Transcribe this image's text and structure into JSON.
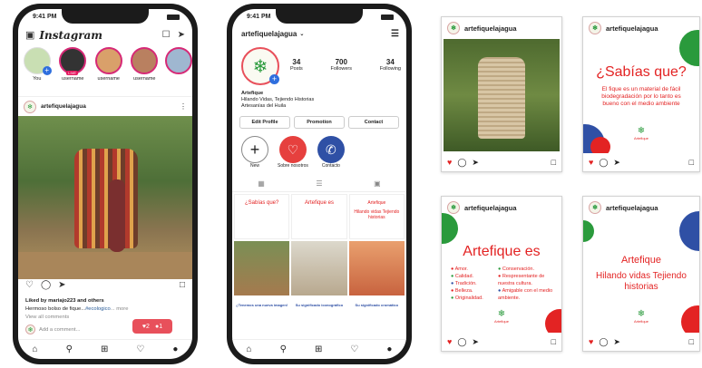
{
  "phone1": {
    "time": "9:41 PM",
    "app_title": "Instagram",
    "stories": [
      "You",
      "username",
      "username",
      "username",
      ""
    ],
    "live_badge": "LIVE",
    "post_user": "artefiquelajagua",
    "liked_by": "Liked by",
    "liked_user": "mariajo223",
    "liked_rest": "and others",
    "caption_user": "Hermoso bolso de fique...",
    "caption_tag": "#ecologico",
    "caption_more": "... more",
    "view_comments": "View all comments",
    "add_comment": "Add a comment...",
    "notif_likes": "2",
    "notif_comments": "1"
  },
  "phone2": {
    "time": "9:41 PM",
    "username": "artefiquelajagua",
    "posts": "34",
    "posts_label": "Posts",
    "followers": "700",
    "followers_label": "Followers",
    "following": "34",
    "following_label": "Following",
    "name": "Artefique",
    "bio1": "Hilando Vidas, Tejiendo Historias",
    "bio2": "Artesanías del Huila",
    "btn_edit": "Edit Profile",
    "btn_promo": "Promotion",
    "btn_contact": "Contact",
    "hl_new": "New",
    "hl_about": "Sobre nosotros",
    "hl_contact": "Contacto",
    "grid_title1": "¿Sabías que?",
    "grid_title2": "Artefique es",
    "grid_title3": "Artefique",
    "grid_title3b": "Hilando vidas Tejiendo historias",
    "grid_caption1": "¿Tenemos una nueva imagen!",
    "grid_caption2": "Su significado iconográfico",
    "grid_caption3": "Su significado cromático"
  },
  "post_user": "artefiquelajagua",
  "card2": {
    "title": "¿Sabías que?",
    "body": "El fique es un material de fácil biodegradación por lo tanto es bueno con el medio ambiente",
    "logo": "Artefique"
  },
  "card3": {
    "title": "Artefique es",
    "col1": [
      "Amor.",
      "Calidad.",
      "Tradición.",
      "Belleza.",
      "Originalidad."
    ],
    "col2": [
      "Conservación.",
      "Respresentante de nuestra cultura.",
      "Amigable con el medio ambiente."
    ],
    "logo": "Artefique"
  },
  "card4": {
    "title": "Artefique",
    "subtitle": "Hilando vidas Tejiendo historias",
    "logo": "Artefique"
  },
  "colors": {
    "red": "#e32323",
    "green": "#2a9a3c",
    "blue": "#2f50a5",
    "accent": "#e8505b"
  }
}
